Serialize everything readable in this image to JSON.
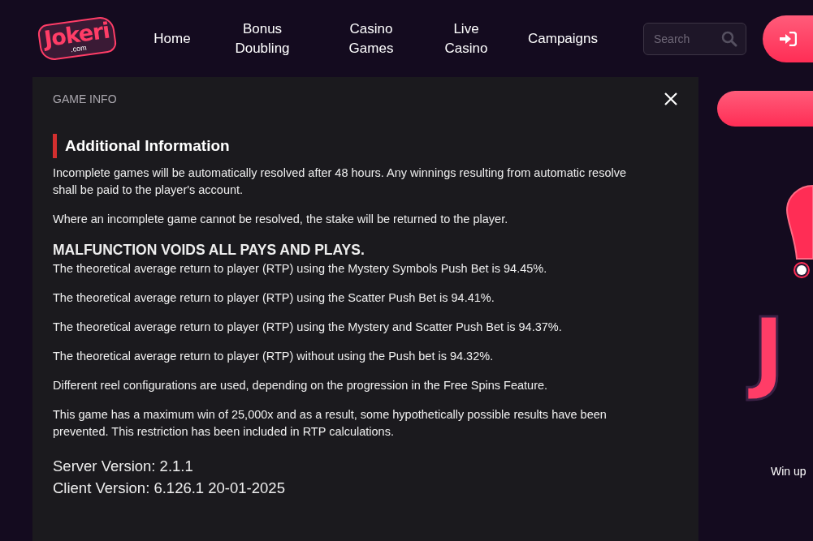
{
  "header": {
    "logo": {
      "name": "Jokeri",
      "suffix": ".com"
    },
    "nav": [
      {
        "label": "Home"
      },
      {
        "label": "Bonus Doubling"
      },
      {
        "label": "Casino Games"
      },
      {
        "label": "Live Casino"
      },
      {
        "label": "Campaigns"
      }
    ],
    "search": {
      "placeholder": "Search"
    }
  },
  "modal": {
    "title": "GAME INFO",
    "section_title": "Additional Information",
    "blocks": [
      {
        "kind": "paragraph",
        "text": "Incomplete games will be automatically resolved after 48 hours. Any winnings resulting from automatic resolve shall be paid to the player's account."
      },
      {
        "kind": "paragraph",
        "text": "Where an incomplete game cannot be resolved, the stake will be returned to the player."
      },
      {
        "kind": "heading",
        "text": "MALFUNCTION VOIDS ALL PAYS AND PLAYS."
      },
      {
        "kind": "tight",
        "text": "The theoretical average return to player (RTP) using the Mystery Symbols Push Bet is 94.45%."
      },
      {
        "kind": "paragraph",
        "text": "The theoretical average return to player (RTP) using the Scatter Push Bet is 94.41%."
      },
      {
        "kind": "paragraph",
        "text": "The theoretical average return to player (RTP) using the Mystery and Scatter Push Bet is 94.37%."
      },
      {
        "kind": "paragraph",
        "text": "The theoretical average return to player (RTP) without using the Push bet is 94.32%."
      },
      {
        "kind": "paragraph",
        "text": "Different reel configurations are used, depending on the progression in the Free Spins Feature."
      },
      {
        "kind": "paragraph",
        "text": "This game has a maximum win of 25,000x and as a result, some hypothetically possible results have been prevented. This restriction has been included in RTP calculations."
      },
      {
        "kind": "version",
        "text": "Server Version: 2.1.1"
      },
      {
        "kind": "version",
        "text": "Client Version: 6.126.1 20-01-2025"
      }
    ]
  },
  "promo": {
    "logo_text": "J",
    "caption": "Win up"
  }
}
